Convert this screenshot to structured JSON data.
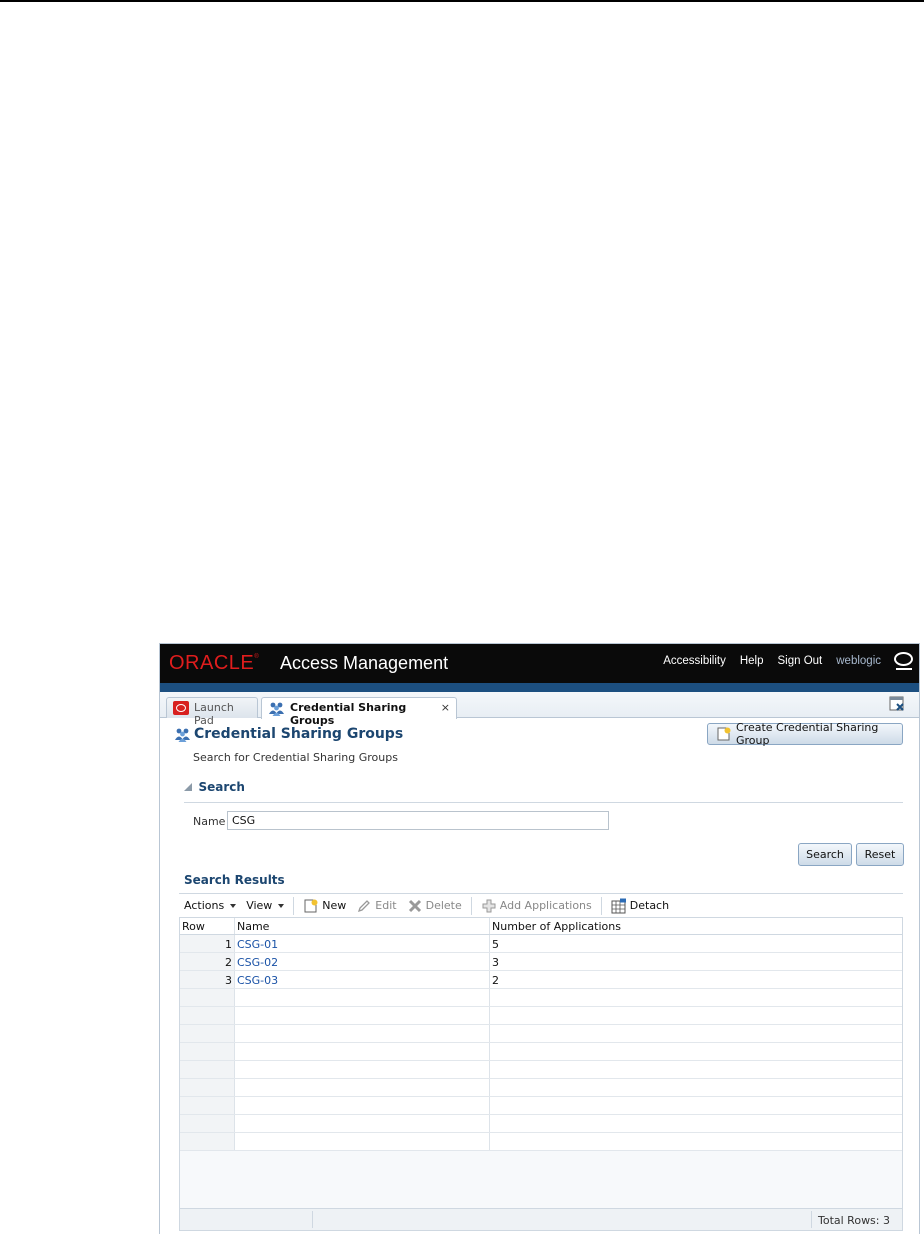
{
  "header": {
    "brand": "ORACLE",
    "product": "Access Management",
    "links": [
      "Accessibility",
      "Help",
      "Sign Out"
    ],
    "user": "weblogic"
  },
  "tabs": [
    {
      "label": "Launch Pad",
      "icon": "oracle-icon"
    },
    {
      "label": "Credential Sharing Groups",
      "icon": "people-group-icon",
      "close": "×"
    }
  ],
  "page": {
    "title": "Credential Sharing Groups",
    "subtitle": "Search for Credential Sharing Groups",
    "create_button": "Create Credential Sharing Group"
  },
  "search": {
    "section_title": "Search",
    "name_label": "Name",
    "name_value": "CSG",
    "search_button": "Search",
    "reset_button": "Reset"
  },
  "results": {
    "title": "Search Results",
    "toolbar": {
      "actions": "Actions",
      "view": "View",
      "new": "New",
      "edit": "Edit",
      "delete": "Delete",
      "add_applications": "Add Applications",
      "detach": "Detach"
    },
    "columns": [
      "Row",
      "Name",
      "Number of Applications"
    ],
    "rows": [
      {
        "row": "1",
        "name": "CSG-01",
        "apps": "5"
      },
      {
        "row": "2",
        "name": "CSG-02",
        "apps": "3"
      },
      {
        "row": "3",
        "name": "CSG-03",
        "apps": "2"
      }
    ],
    "total_rows": "Total Rows: 3"
  },
  "colors": {
    "header_bg": "#0a0a0a",
    "brand_red": "#e01d1d",
    "band_blue": "#1c4f80",
    "title_blue": "#1c4670",
    "link_blue": "#1a52a6"
  }
}
